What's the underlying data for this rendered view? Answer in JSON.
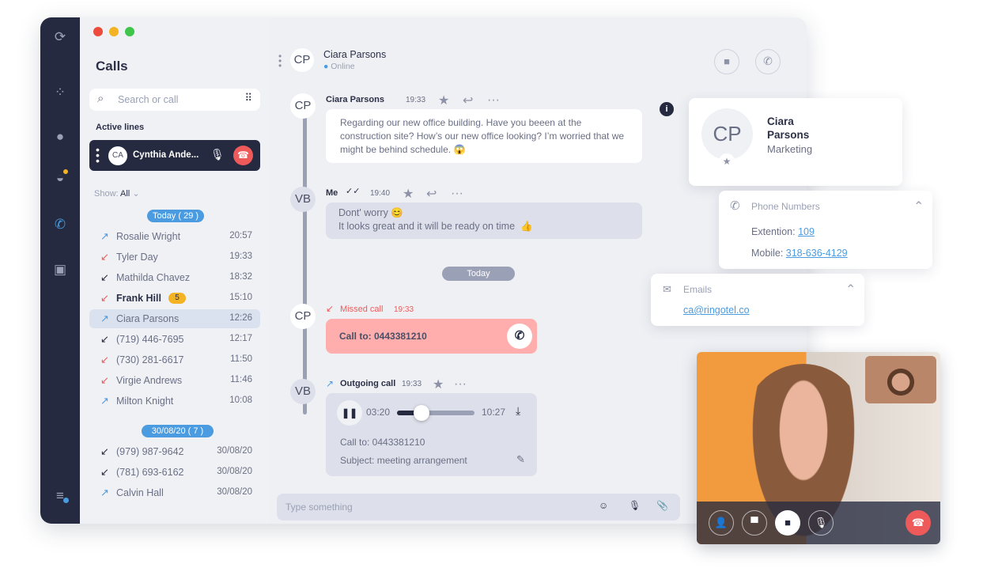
{
  "window": {
    "traffic_colors": [
      "#ee4b3f",
      "#f3b323",
      "#3fc64a"
    ]
  },
  "sidebar": {
    "items": [
      {
        "icon": "logo-icon"
      },
      {
        "icon": "apps-icon"
      },
      {
        "icon": "contact-icon"
      },
      {
        "icon": "chat-icon",
        "badge": true
      },
      {
        "icon": "phone-icon",
        "active": true
      },
      {
        "icon": "address-book-icon"
      },
      {
        "icon": "menu-icon"
      }
    ]
  },
  "calls": {
    "title": "Calls",
    "search_placeholder": "Search or call",
    "active_lines_label": "Active lines",
    "active_line": {
      "initials": "CA",
      "name": "Cynthia Ande..."
    },
    "show_label": "Show:",
    "show_value": "All",
    "groups": [
      {
        "label": "Today ( 29 )",
        "items": [
          {
            "name": "Rosalie Wright",
            "time": "20:57",
            "type": "outgoing"
          },
          {
            "name": "Tyler Day",
            "time": "19:33",
            "type": "missed"
          },
          {
            "name": "Mathilda Chavez",
            "time": "18:32",
            "type": "incoming"
          },
          {
            "name": "Frank Hill",
            "time": "15:10",
            "type": "missed",
            "badge": "5",
            "bold": true
          },
          {
            "name": "Ciara Parsons",
            "time": "12:26",
            "type": "outgoing",
            "selected": true
          },
          {
            "name": "(719) 446-7695",
            "time": "12:17",
            "type": "incoming"
          },
          {
            "name": "(730) 281-6617",
            "time": "11:50",
            "type": "missed"
          },
          {
            "name": "Virgie Andrews",
            "time": "11:46",
            "type": "missed"
          },
          {
            "name": "Milton Knight",
            "time": "10:08",
            "type": "outgoing"
          }
        ]
      },
      {
        "label": "30/08/20 ( 7 )",
        "items": [
          {
            "name": "(979) 987-9642",
            "time": "30/08/20",
            "type": "incoming"
          },
          {
            "name": "(781) 693-6162",
            "time": "30/08/20",
            "type": "incoming"
          },
          {
            "name": "Calvin Hall",
            "time": "30/08/20",
            "type": "outgoing"
          }
        ]
      }
    ]
  },
  "chat": {
    "header": {
      "initials": "CP",
      "name": "Ciara Parsons",
      "status": "Online"
    },
    "msg1": {
      "initials": "CP",
      "sender": "Ciara Parsons",
      "time": "19:33",
      "text": "Regarding our new office building. Have you beeen at the construction site? How’s our new office looking? I’m worried that we might be behind schedule.",
      "emoji": "😱"
    },
    "msg2": {
      "initials": "VB",
      "sender": "Me",
      "time": "19:40",
      "line1": "Dont' worry",
      "emoji1": "😊",
      "line2": "It looks great and it will be ready on time",
      "emoji2": "👍"
    },
    "divider": "Today",
    "missed": {
      "initials": "CP",
      "label": "Missed call",
      "time": "19:33",
      "text": "Call to: 0443381210"
    },
    "outgoing": {
      "initials": "VB",
      "label": "Outgoing call",
      "time": "19:33",
      "elapsed": "03:20",
      "duration": "10:27",
      "progress": 0.32,
      "call_to": "Call to: 0443381210",
      "subject": "Subject: meeting arrangement"
    },
    "input_placeholder": "Type something"
  },
  "contact": {
    "initials": "CP",
    "first": "Ciara",
    "last": "Parsons",
    "department": "Marketing",
    "phones_title": "Phone Numbers",
    "ext_label": "Extention:",
    "ext": "109",
    "mobile_label": "Mobile:",
    "mobile": "318-636-4129",
    "emails_title": "Emails",
    "email": "ca@ringotel.co"
  },
  "colors": {
    "accent": "#4a9be0",
    "missed": "#ee5a5a",
    "dark": "#252a40",
    "missed_bg": "#ffadad",
    "badge": "#f3b323"
  }
}
